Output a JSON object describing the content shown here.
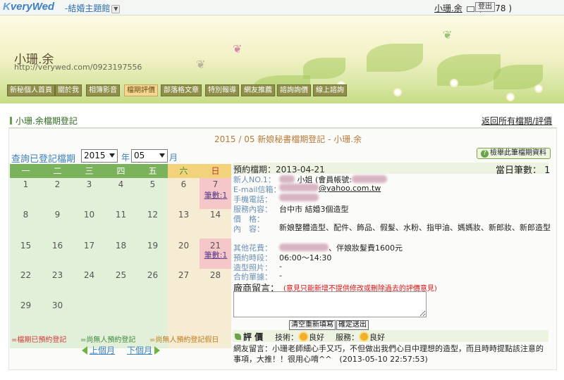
{
  "topbar": {
    "logo_prefix": "K",
    "logo_text": "veryWed",
    "site_name": "-結婚主題館",
    "user_name": "小珊.余",
    "user_count": "( 1278 )",
    "logout_label": "登出"
  },
  "banner": {
    "owner_name": "小珊.余",
    "owner_url": "http://verywed.com/0923197556",
    "nav": [
      "新秘個人首頁",
      "關於我",
      "相簿影音",
      "檔期評價",
      "部落格文章",
      "特別報導",
      "網友推薦",
      "諮詢詢價",
      "線上諮詢"
    ],
    "active_nav": "檔期評價"
  },
  "section": {
    "title": "小珊.余檔期登記",
    "back_link": "返回所有檔期/評價"
  },
  "panel": {
    "title": "2015 / 05 新娘秘書檔期登記 - 小珊.余",
    "query_label": "查詢已登記檔期",
    "year_value": "2015",
    "year_unit": "年",
    "month_value": "05",
    "month_unit": "月"
  },
  "calendar": {
    "weekdays": [
      "一",
      "二",
      "三",
      "四",
      "五",
      "六",
      "日"
    ],
    "weeks": [
      [
        "1",
        "2",
        "3",
        "4",
        "5",
        "6",
        "7"
      ],
      [
        "8",
        "9",
        "10",
        "11",
        "12",
        "13",
        "14"
      ],
      [
        "15",
        "16",
        "17",
        "18",
        "19",
        "20",
        "21"
      ],
      [
        "22",
        "23",
        "24",
        "25",
        "26",
        "27",
        "28"
      ],
      [
        "29",
        "30",
        "",
        "",
        "",
        "",
        ""
      ]
    ],
    "counts": {
      "7": "筆數:1",
      "21": "筆數:1"
    },
    "legend": [
      {
        "text": "=檔期已預約登記",
        "color": "#d23a3a"
      },
      {
        "text": "=尚無人預約登記",
        "color": "#3d8a3d"
      },
      {
        "text": "=尚無人預約登記假日",
        "color": "#c07a1a"
      }
    ],
    "prev_label": "上個月",
    "next_label": "下個月"
  },
  "detail": {
    "report_button": "檢舉此筆檔期資料",
    "date_label": "預約檔期：2013-04-21",
    "daily_count": "當日筆數： 1",
    "rows": [
      {
        "label": "新人NO.1：",
        "value": "小姐 (會員帳號:"
      },
      {
        "label": "E-mail信箱：",
        "value": "@yahoo.com.tw"
      },
      {
        "label": "手機電話：",
        "value": ""
      },
      {
        "label": "服務內容：",
        "value": "台中市 結婚3個造型"
      },
      {
        "label": "價　格：",
        "value": ""
      },
      {
        "label": "內　容：",
        "value": "新娘整體造型、配件、飾品、假髮、水粉、指甲油、媽媽妝、新郎妝、新郎造型"
      },
      {
        "label": "其他花費：",
        "value": "、伴娘妝髮費1600元"
      },
      {
        "label": "預約時段：",
        "value": "06:00～14:30"
      },
      {
        "label": "造型照片：",
        "value": "-"
      },
      {
        "label": "合約單據：",
        "value": "-"
      }
    ],
    "comment_title": "廠商留言：",
    "comment_note": "(意見只能新增不提供修改或刪除過去的評價意見)",
    "clear_button": "清空重新填寫",
    "submit_button": "確定送出",
    "eval_title": "評 價",
    "tech_label": "技術：",
    "tech_value": "良好",
    "service_label": "服務：",
    "service_value": "良好",
    "review_text": "網友留言：小珊老師細心手又巧，不但做出我們心目中理想的造型，而且時時提點該注意的事項，大推！！很用心唷^^　(2013-05-10 22:57:53)"
  }
}
